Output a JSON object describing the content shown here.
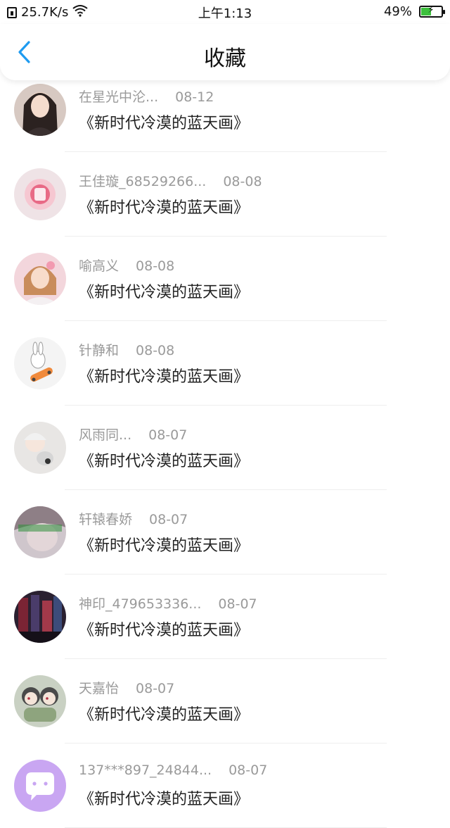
{
  "status_bar": {
    "network_speed": "25.7K/s",
    "time": "上午1:13",
    "battery_percent": "49%",
    "battery_level": 0.49,
    "icons": [
      "sim-icon",
      "wifi-icon",
      "battery-icon"
    ]
  },
  "header": {
    "title": "收藏",
    "back_icon": "chevron-left-icon",
    "accent_color": "#1E9BF0"
  },
  "items": [
    {
      "user": "在星光中沦...",
      "date": "08-12",
      "title": "《新时代冷漠的蓝天画》"
    },
    {
      "user": "王佳璇_68529266...",
      "date": "08-08",
      "title": "《新时代冷漠的蓝天画》"
    },
    {
      "user": "喻高义",
      "date": "08-08",
      "title": "《新时代冷漠的蓝天画》"
    },
    {
      "user": "针静和",
      "date": "08-08",
      "title": "《新时代冷漠的蓝天画》"
    },
    {
      "user": "风雨同...",
      "date": "08-07",
      "title": "《新时代冷漠的蓝天画》"
    },
    {
      "user": "轩辕春娇",
      "date": "08-07",
      "title": "《新时代冷漠的蓝天画》"
    },
    {
      "user": "神印_479653336...",
      "date": "08-07",
      "title": "《新时代冷漠的蓝天画》"
    },
    {
      "user": "天嘉怡",
      "date": "08-07",
      "title": "《新时代冷漠的蓝天画》"
    },
    {
      "user": "137***897_24844...",
      "date": "08-07",
      "title": "《新时代冷漠的蓝天画》"
    }
  ]
}
